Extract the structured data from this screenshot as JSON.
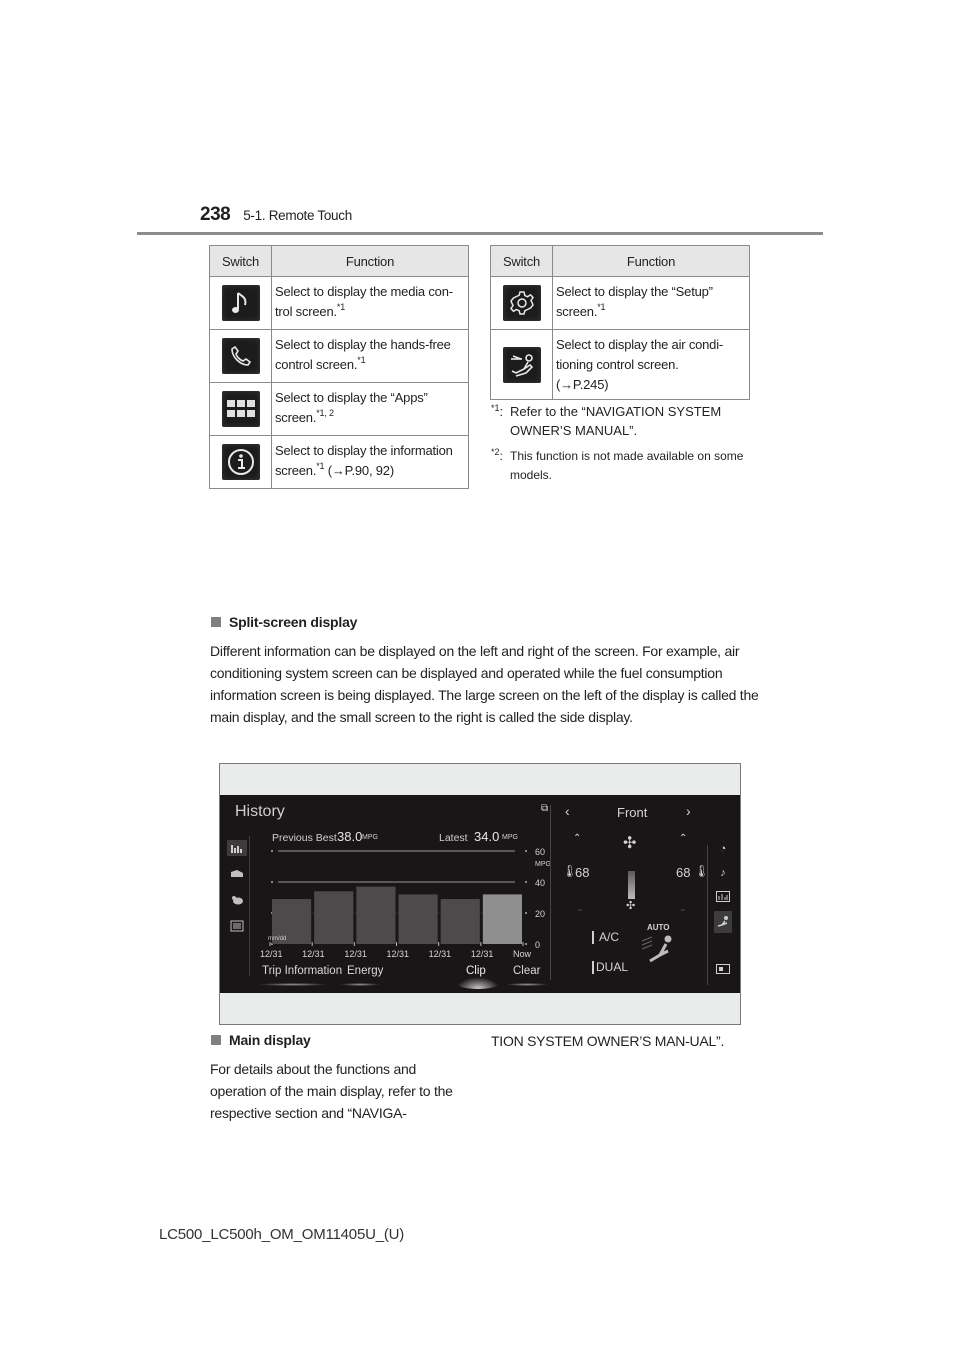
{
  "header": {
    "page_number": "238",
    "section": "5-1. Remote Touch"
  },
  "switch_table_left": {
    "columns": [
      "Switch",
      "Function"
    ],
    "rows": [
      {
        "icon": "music-note-icon",
        "text": "Select to display the media con-trol screen.",
        "note": "*1",
        "ref": ""
      },
      {
        "icon": "phone-icon",
        "text": "Select to display the hands-free control screen.",
        "note": "*1",
        "ref": ""
      },
      {
        "icon": "apps-grid-icon",
        "text": "Select to display the “Apps” screen.",
        "note": "*1, 2",
        "ref": ""
      },
      {
        "icon": "info-icon",
        "text": "Select to display the information screen.",
        "note": "*1",
        "ref": " (→P.90, 92)"
      }
    ]
  },
  "switch_table_right": {
    "columns": [
      "Switch",
      "Function"
    ],
    "rows": [
      {
        "icon": "gear-icon",
        "text": "Select to display the “Setup” screen.",
        "note": "*1",
        "ref": ""
      },
      {
        "icon": "climate-seat-icon",
        "text": "Select to display the air condi-tioning control screen.",
        "note": "",
        "ref": "(→P.245)"
      }
    ]
  },
  "footnotes": [
    {
      "mark": "*1",
      "text": "Refer to the “NAVIGATION SYSTEM OWNER’S MANUAL”."
    },
    {
      "mark": "*2",
      "text": "This function is not made available on some models."
    }
  ],
  "split_screen": {
    "heading": "Split-screen display",
    "body": "Different information can be displayed on the left and right of the screen. For example, air conditioning system screen can be displayed and operated while the fuel consumption information screen is being displayed. The large screen on the left of the display is called the main display, and the small screen to the right is called the side display."
  },
  "screen": {
    "main": {
      "title": "History",
      "previous_best_label": "Previous Best",
      "previous_best_value": "38.0",
      "latest_label": "Latest",
      "latest_value": "34.0",
      "unit": "MPG",
      "left_rail_icons": [
        "bar-chart-icon",
        "car-icon",
        "energy-icon",
        "list-icon"
      ],
      "buttons": [
        "Trip Information",
        "Energy",
        "Clip",
        "Clear"
      ]
    },
    "side": {
      "title": "Front",
      "left_temp": "68",
      "right_temp": "68",
      "ac_label": "A/C",
      "dual_label": "DUAL",
      "auto_label": "AUTO",
      "right_rail_icons": [
        "radio-icon",
        "music-note-icon",
        "chart-icon",
        "climate-seat-icon",
        "screen-icon"
      ]
    }
  },
  "chart_data": {
    "type": "bar",
    "title": "History",
    "categories": [
      "12/31",
      "12/31",
      "12/31",
      "12/31",
      "12/31",
      "12/31",
      "Now"
    ],
    "values": [
      29,
      34,
      37,
      32,
      29,
      32
    ],
    "highlight_index": 5,
    "xlabel": "mm/dd",
    "ylabel": "MPG",
    "ylim": [
      0,
      60
    ],
    "yticks": [
      0,
      20,
      40,
      60
    ],
    "grid": true,
    "legend": "none"
  },
  "main_display": {
    "heading": "Main display",
    "body_left": "For details about the functions and operation of the main display, refer to the respective section and “NAVIGA-",
    "body_right": "TION SYSTEM OWNER’S MAN-UAL”."
  },
  "footer": {
    "doc_id": "LC500_LC500h_OM_OM11405U_(U)"
  }
}
